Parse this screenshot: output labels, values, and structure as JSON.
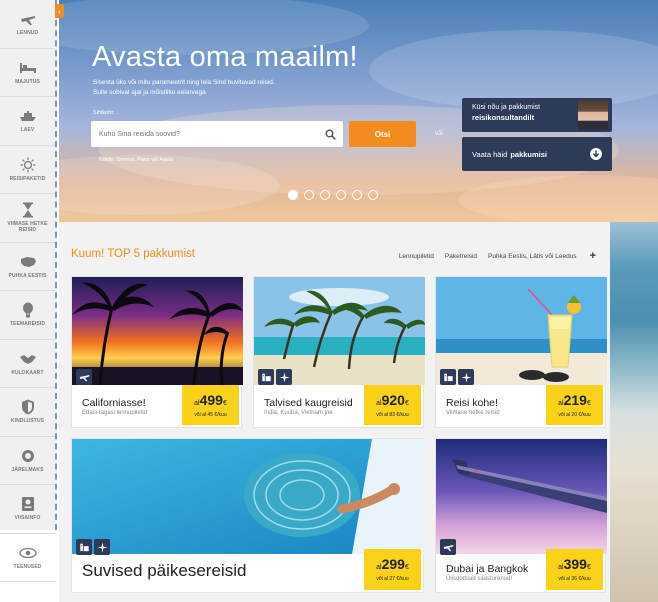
{
  "sidebar": {
    "items": [
      {
        "label": "LENNUD",
        "icon": "plane-icon"
      },
      {
        "label": "MAJUTUS",
        "icon": "bed-icon"
      },
      {
        "label": "LAEV",
        "icon": "ship-icon"
      },
      {
        "label": "REISIPAKETID",
        "icon": "sun-icon"
      },
      {
        "label": "VIIMASE HETKE REISID",
        "icon": "hourglass-icon"
      },
      {
        "label": "PUHKA EESTIS",
        "icon": "estonia-map-icon"
      },
      {
        "label": "TEEMAREISID",
        "icon": "balloon-icon"
      },
      {
        "label": "KULDKAART",
        "icon": "handshake-icon"
      },
      {
        "label": "KINDLUSTUS",
        "icon": "shield-icon"
      },
      {
        "label": "JÄRELMAKS",
        "icon": "wallet-icon"
      },
      {
        "label": "VIISAINFO",
        "icon": "visa-icon"
      },
      {
        "label": "TEENUSED",
        "icon": "eye-icon"
      }
    ]
  },
  "hero": {
    "title": "Avasta oma maailm!",
    "subtitle_line1": "Sisesta üks või mitu parameetrit ning leia Sind huvitavad reisid.",
    "subtitle_line2": "Sulle sobival ajal ja mõistliku eelarvega",
    "field_label": "Sihtkoht:",
    "search_placeholder": "Kuhu Sina reisida soovid?",
    "search_button": "Otsi",
    "or_text": "või",
    "hint": "Näide: Serena, Paris või Aasia",
    "consult_line1": "Küsi nõu ja pakkumist",
    "consult_line2": "reisikonsultandilt",
    "offers_prefix": "Vaata häid",
    "offers_bold": "pakkumisi"
  },
  "carousel": {
    "count": 6,
    "active": 0
  },
  "top5": {
    "title": "Kuum! TOP 5 pakkumist",
    "tabs": [
      "Lennupiletid",
      "Paketreisid",
      "Puhka Eestis, Lätis või Leedus"
    ],
    "plus": "+"
  },
  "cards": [
    {
      "title": "Californiasse!",
      "subtitle": "Edasi-tagasi lennupiletid",
      "prefix": "al",
      "price": "499",
      "currency": "€",
      "note": "või al 45 €/kuu",
      "icons": [
        "plane-icon"
      ]
    },
    {
      "title": "Talvised kaugreisid",
      "subtitle": "India, Kuuba, Vietnam jne",
      "prefix": "al",
      "price": "920",
      "currency": "€",
      "note": "või al 83 €/kuu",
      "icons": [
        "hotel-icon",
        "plane-icon"
      ]
    },
    {
      "title": "Reisi kohe!",
      "subtitle": "Viimase hetke reisid",
      "prefix": "al",
      "price": "219",
      "currency": "€",
      "note": "või al 20 €/kuu",
      "icons": [
        "hotel-icon",
        "plane-icon"
      ]
    },
    {
      "title": "Suvised päikesereisid",
      "subtitle": "",
      "prefix": "al",
      "price": "299",
      "currency": "€",
      "note": "või al 27 €/kuu",
      "icons": [
        "hotel-icon",
        "plane-icon"
      ]
    },
    {
      "title": "Dubai ja Bangkok",
      "subtitle": "Ülisoodsad säästurenud!",
      "prefix": "al",
      "price": "399",
      "currency": "€",
      "note": "või al 36 €/kuu",
      "icons": [
        "plane-icon"
      ]
    }
  ],
  "colors": {
    "accent": "#f28c1e",
    "navy": "#2d3a58",
    "price_bg": "#fbd21a"
  }
}
